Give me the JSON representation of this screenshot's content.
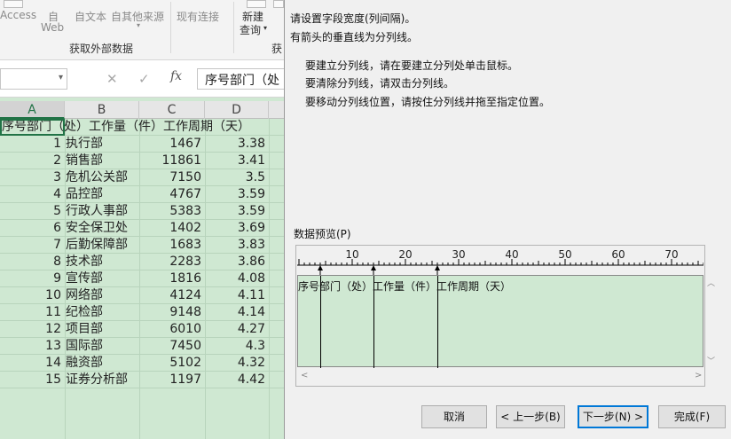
{
  "ribbon": {
    "access": "Access",
    "from_web": "自\nWeb",
    "from_web_1": "自",
    "from_web_2": "Web",
    "from_text": "自文本",
    "from_other": "自其他来源",
    "existing_conn": "现有连接",
    "new_query_1": "新建",
    "new_query_2": "查询",
    "group_label": "获取外部数据",
    "group_label_2": "获"
  },
  "formula_bar": {
    "cancel": "✕",
    "confirm": "✓",
    "fx": "fx",
    "value": "序号部门（处"
  },
  "sheet": {
    "columns": [
      "A",
      "B",
      "C",
      "D"
    ],
    "header_row": "序号部门（处）工作量（件）工作周期（天）",
    "rows": [
      {
        "no": "1",
        "dept": "执行部",
        "work": "1467",
        "days": "3.38"
      },
      {
        "no": "2",
        "dept": "销售部",
        "work": "11861",
        "days": "3.41"
      },
      {
        "no": "3",
        "dept": "危机公关部",
        "work": "7150",
        "days": "3.5"
      },
      {
        "no": "4",
        "dept": "品控部",
        "work": "4767",
        "days": "3.59"
      },
      {
        "no": "5",
        "dept": "行政人事部",
        "work": "5383",
        "days": "3.59"
      },
      {
        "no": "6",
        "dept": "安全保卫处",
        "work": "1402",
        "days": "3.69"
      },
      {
        "no": "7",
        "dept": "后勤保障部",
        "work": "1683",
        "days": "3.83"
      },
      {
        "no": "8",
        "dept": "技术部",
        "work": "2283",
        "days": "3.86"
      },
      {
        "no": "9",
        "dept": "宣传部",
        "work": "1816",
        "days": "4.08"
      },
      {
        "no": "10",
        "dept": "网络部",
        "work": "4124",
        "days": "4.11"
      },
      {
        "no": "11",
        "dept": "纪检部",
        "work": "9148",
        "days": "4.14"
      },
      {
        "no": "12",
        "dept": "项目部",
        "work": "6010",
        "days": "4.27"
      },
      {
        "no": "13",
        "dept": "国际部",
        "work": "7450",
        "days": "4.3"
      },
      {
        "no": "14",
        "dept": "融资部",
        "work": "5102",
        "days": "4.32"
      },
      {
        "no": "15",
        "dept": "证券分析部",
        "work": "1197",
        "days": "4.42"
      }
    ]
  },
  "dialog": {
    "instruction_1": "请设置字段宽度(列间隔)。",
    "instruction_2": "有箭头的垂直线为分列线。",
    "tip_create": "要建立分列线，请在要建立分列处单击鼠标。",
    "tip_delete": "要清除分列线，请双击分列线。",
    "tip_move": "要移动分列线位置，请按住分列线并拖至指定位置。",
    "preview_label": "数据预览(P)",
    "ruler_ticks": [
      "10",
      "20",
      "30",
      "40",
      "50",
      "60",
      "70"
    ],
    "preview_data": "序号部门（处）工作量（件）工作周期（天）",
    "break_positions": [
      4,
      14,
      26
    ],
    "buttons": {
      "cancel": "取消",
      "back": "< 上一步(B)",
      "next": "下一步(N) >",
      "finish": "完成(F)"
    }
  }
}
